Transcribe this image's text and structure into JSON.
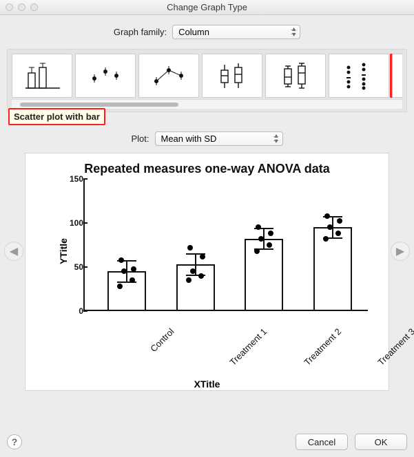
{
  "window": {
    "title": "Change Graph Type"
  },
  "graph_family": {
    "label": "Graph family:",
    "selected": "Column",
    "thumbs": [
      {
        "name": "bar",
        "label": "Bar"
      },
      {
        "name": "scatter-se",
        "label": "Scatter +SE"
      },
      {
        "name": "scatter-line",
        "label": "Scatter + line"
      },
      {
        "name": "boxplot",
        "label": "Box plot"
      },
      {
        "name": "box-min-max",
        "label": "Box min-max"
      },
      {
        "name": "aligned-dot",
        "label": "Aligned dot"
      },
      {
        "name": "scatter-with-bar",
        "label": "Scatter plot with bar"
      }
    ],
    "selected_thumb_index": 6,
    "tooltip": "Scatter plot with bar"
  },
  "plot": {
    "label": "Plot:",
    "selected": "Mean with SD"
  },
  "buttons": {
    "cancel": "Cancel",
    "ok": "OK"
  },
  "chart_data": {
    "type": "bar",
    "title": "Repeated measures one-way ANOVA data",
    "xlabel": "XTitle",
    "ylabel": "YTitle",
    "ylim": [
      0,
      150
    ],
    "yticks": [
      0,
      50,
      100,
      150
    ],
    "categories": [
      "Control",
      "Treatment 1",
      "Treatment 2",
      "Treatment 3"
    ],
    "series": [
      {
        "name": "Mean",
        "values": [
          45,
          53,
          82,
          95
        ]
      },
      {
        "name": "SD",
        "values": [
          12,
          12,
          12,
          12
        ]
      }
    ],
    "points": [
      [
        28,
        35,
        45,
        48,
        58
      ],
      [
        35,
        40,
        45,
        62,
        72
      ],
      [
        68,
        75,
        82,
        88,
        95
      ],
      [
        82,
        88,
        95,
        102,
        108
      ]
    ]
  }
}
